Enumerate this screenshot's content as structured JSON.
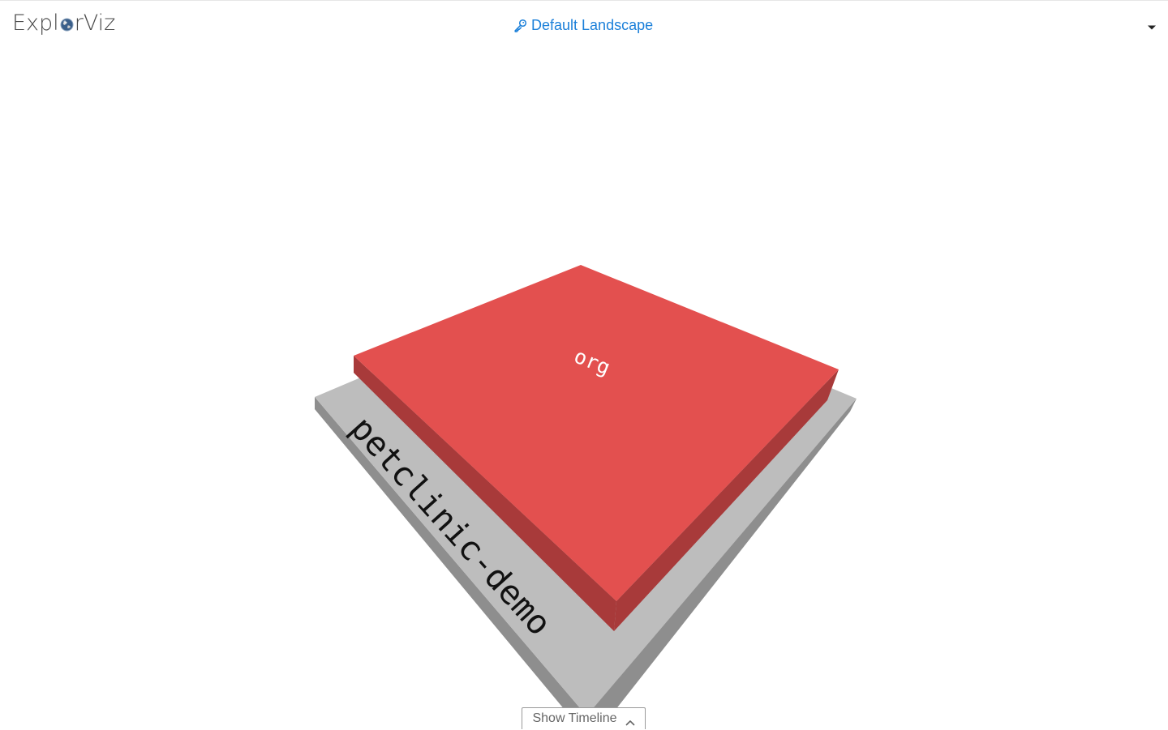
{
  "app": {
    "logo_prefix": "Expl",
    "logo_suffix": "rViz"
  },
  "header": {
    "landscape_title": "Default Landscape",
    "key_icon": "key-icon",
    "menu_icon": "caret-down-icon"
  },
  "visualization": {
    "application_label": "petclinic-demo",
    "package_label": "org",
    "colors": {
      "foundation_top": "#bdbdbd",
      "foundation_side": "#8e8e8e",
      "package_top": "#e3504f",
      "package_side": "#a83a3a"
    }
  },
  "timeline": {
    "toggle_label": "Show Timeline",
    "toggle_icon": "chevron-up-icon"
  },
  "colors": {
    "accent": "#1a7fd9"
  }
}
